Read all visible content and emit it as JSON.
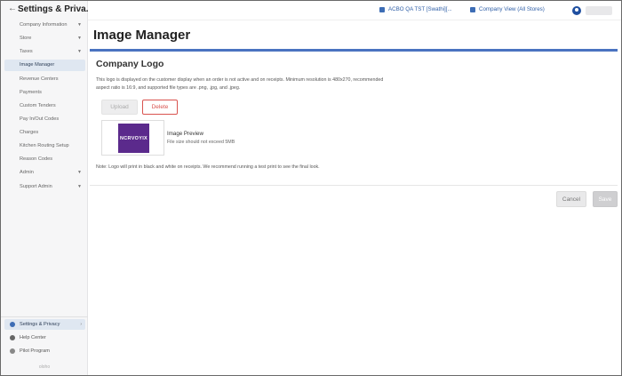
{
  "sidebar": {
    "title": "Settings & Priva...",
    "back_icon": "arrow-left-icon",
    "items": [
      {
        "label": "Company Information",
        "chevron": "chevron-down-icon"
      },
      {
        "label": "Store",
        "chevron": "chevron-down-icon"
      },
      {
        "label": "Taxes",
        "chevron": "chevron-down-icon"
      },
      {
        "label": "Image Manager"
      },
      {
        "label": "Revenue Centers"
      },
      {
        "label": "Payments"
      },
      {
        "label": "Custom Tenders"
      },
      {
        "label": "Pay In/Out Codes"
      },
      {
        "label": "Charges"
      },
      {
        "label": "Kitchen Routing Setup"
      },
      {
        "label": "Reason Codes"
      },
      {
        "label": "Admin",
        "chevron": "chevron-down-icon"
      },
      {
        "label": "Support Admin",
        "chevron": "chevron-down-icon"
      }
    ],
    "bottom": [
      {
        "label": "Settings & Privacy",
        "icon": "gear-icon"
      },
      {
        "label": "Help Center",
        "icon": "help-icon"
      },
      {
        "label": "Pilot Program",
        "icon": "pilot-icon"
      }
    ],
    "footer": "oloho"
  },
  "topbar": {
    "store_label": "ACBO QA TST [Swathi][...",
    "view_label": "Company View (All Stores)"
  },
  "page": {
    "title": "Image Manager"
  },
  "logo_section": {
    "title": "Company Logo",
    "description": "This logo is displayed on the customer display when an order is not active and on receipts. Minimum resolution is 480x270, recommended aspect ratio is 16:9, and supported file types are .png, .jpg, and .jpeg.",
    "upload_label": "Upload",
    "delete_label": "Delete",
    "logo_text": "NCRVOYIX",
    "preview_title": "Image Preview",
    "preview_sub": "File size should not exceed 5MB",
    "note": "Note: Logo will print in black and white on receipts. We recommend running a test print to see the final look."
  },
  "footer_actions": {
    "cancel_label": "Cancel",
    "save_label": "Save"
  },
  "colors": {
    "accent": "#4a73c0",
    "logo_bg": "#5b2a8c",
    "delete": "#d9534f"
  }
}
